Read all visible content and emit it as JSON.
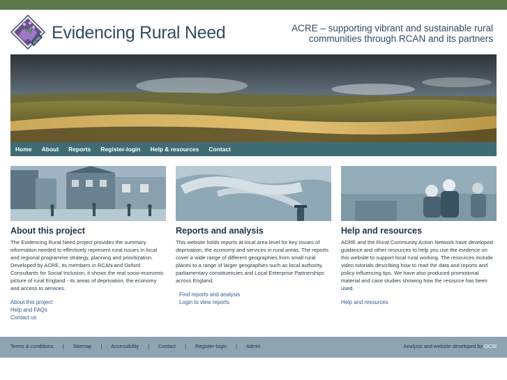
{
  "header": {
    "site_title": "Evidencing Rural Need",
    "tagline_line1": "ACRE – supporting vibrant and sustainable rural",
    "tagline_line2": "communities through RCAN and its partners",
    "logo_text": "ACRE"
  },
  "nav": {
    "items": [
      "Home",
      "About",
      "Reports",
      "Register-login",
      "Help & resources",
      "Contact"
    ]
  },
  "columns": [
    {
      "title": "About this project",
      "body": "The Evidencing Rural Need project provides the summary information needed to effectively represent rural issues in local and regional programme strategy, planning and prioritization. Developed by ACRE, its members in RCAN and Oxford Consultants for Social Inclusion, it shows the real socio-economic picture of rural England - its areas of deprivation, the economy and access to services.",
      "links": [
        "About this project",
        "Help and FAQs",
        "Contact us"
      ]
    },
    {
      "title": "Reports and analysis",
      "body": "This website holds reports at local area level for key issues of deprivation, the economy and services in rural areas. The reports cover a wide range of different geographies from small rural places to a range of larger geographies such as local authority, parliamentary constituencies and Local Enterprise Partnerships across England.",
      "links": [
        "Find reports and analysis",
        "Login to view reports"
      ]
    },
    {
      "title": "Help and resources",
      "body": "ACRE and the Rural Community Action Network have developed guidance and other resources to help you use the evidence on this website to support local rural working. The resources include video tutorials describing how to read the data and reports and policy influencing tips. We have also produced promotional material and case studies showing how the resource has been used.",
      "links": [
        "Help and resources"
      ]
    }
  ],
  "footer": {
    "links": [
      "Terms & conditions",
      "Sitemap",
      "Accessibility",
      "Contact",
      "Register-login",
      "Admin"
    ],
    "separator": "|",
    "credit_text": "Analysis and website developed by",
    "credit_link": "OCSI"
  },
  "colors": {
    "top_bar": "#5a7a4a",
    "nav_bg": "#3f6c74",
    "footer_bg": "#8ea4b0",
    "title_text": "#2f4a66",
    "link_text": "#2f5a8a"
  }
}
